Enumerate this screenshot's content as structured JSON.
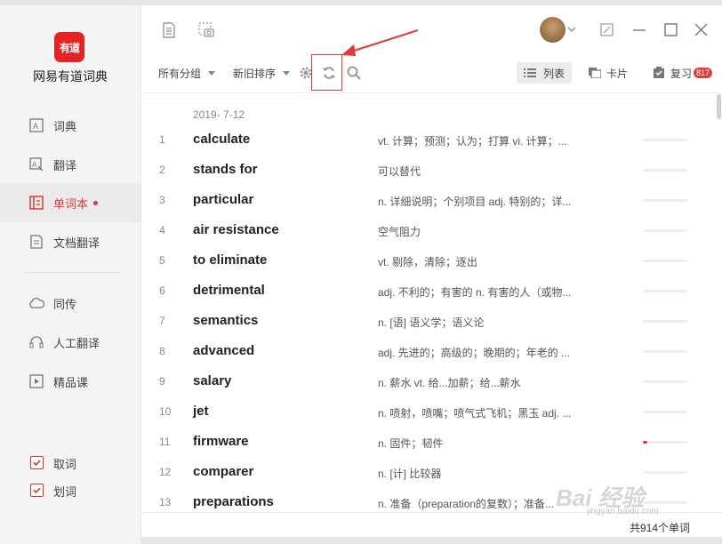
{
  "app": {
    "name": "网易有道词典",
    "logo_text": "有道"
  },
  "window_controls": [
    "minimize-icon",
    "maximize-icon",
    "close-icon"
  ],
  "sidebar": {
    "items": [
      {
        "label": "词典",
        "icon": "dictionary-icon"
      },
      {
        "label": "翻译",
        "icon": "translate-icon"
      },
      {
        "label": "单词本",
        "icon": "wordbook-icon",
        "active": true
      },
      {
        "label": "文档翻译",
        "icon": "document-icon"
      },
      {
        "label": "同传",
        "icon": "cloud-icon"
      },
      {
        "label": "人工翻译",
        "icon": "headset-icon"
      },
      {
        "label": "精品课",
        "icon": "video-icon"
      }
    ],
    "checkboxes": [
      {
        "label": "取词",
        "checked": true
      },
      {
        "label": "划词",
        "checked": true
      }
    ]
  },
  "toolbar": {
    "group_filter": "所有分组",
    "sort_filter": "新旧排序",
    "view_list_label": "列表",
    "view_card_label": "卡片",
    "review_label": "复习",
    "review_badge": "817"
  },
  "wordlist": {
    "date": "2019- 7-12",
    "rows": [
      {
        "num": "1",
        "word": "calculate",
        "def": "vt. 计算；预测；认为；打算 vi. 计算；...",
        "progress": 0
      },
      {
        "num": "2",
        "word": "stands for",
        "def": "可以替代",
        "progress": 0
      },
      {
        "num": "3",
        "word": "particular",
        "def": "n. 详细说明；个别项目 adj. 特别的；详...",
        "progress": 0
      },
      {
        "num": "4",
        "word": "air resistance",
        "def": "空气阻力",
        "progress": 0
      },
      {
        "num": "5",
        "word": "to eliminate",
        "def": "vt. 剔除，清除；逐出",
        "progress": 0
      },
      {
        "num": "6",
        "word": "detrimental",
        "def": "adj. 不利的；有害的 n. 有害的人（或物...",
        "progress": 0
      },
      {
        "num": "7",
        "word": "semantics",
        "def": "n. [语] 语义学；语义论",
        "progress": 0
      },
      {
        "num": "8",
        "word": "advanced",
        "def": "adj. 先进的；高级的；晚期的；年老的 ...",
        "progress": 0
      },
      {
        "num": "9",
        "word": "salary",
        "def": "n. 薪水 vt. 给...加薪；给...薪水",
        "progress": 0
      },
      {
        "num": "10",
        "word": "jet",
        "def": "n. 喷射，喷嘴；喷气式飞机；黑玉 adj. ...",
        "progress": 0
      },
      {
        "num": "11",
        "word": "firmware",
        "def": "n. 固件；韧件",
        "progress": 10
      },
      {
        "num": "12",
        "word": "comparer",
        "def": "n. [计] 比较器",
        "progress": 0
      },
      {
        "num": "13",
        "word": "preparations",
        "def": "n. 准备（preparation的复数）；准备...",
        "progress": 0
      }
    ]
  },
  "footer": {
    "count": "共914个单词"
  },
  "watermark": {
    "text": "Bai 经验",
    "url_text": "jingyan.baidu.com"
  },
  "colors": {
    "accent": "#e33b3b",
    "sidebar_bg": "#f4f4f4"
  }
}
